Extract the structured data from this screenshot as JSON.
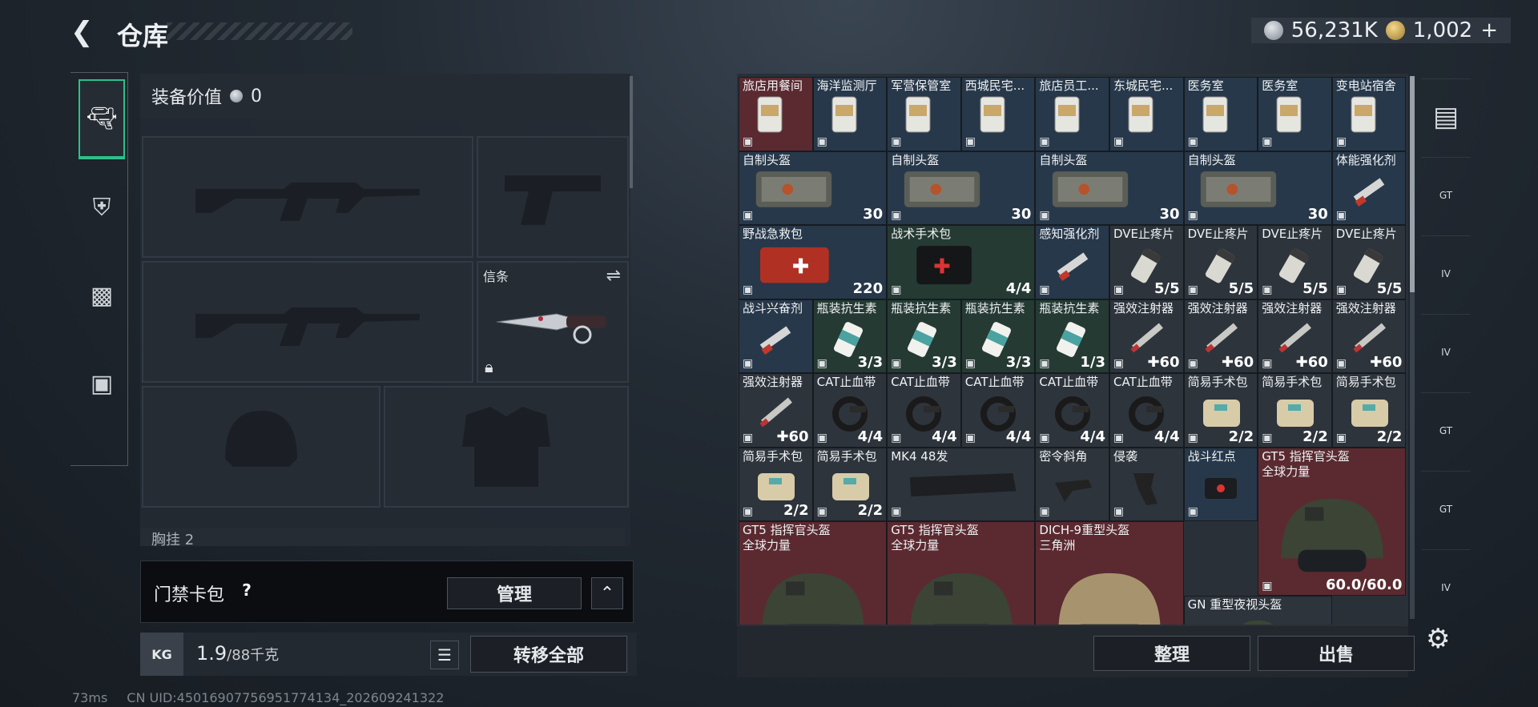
{
  "header": {
    "title": "仓库",
    "silver": "56,231K",
    "gold": "1,002",
    "gold_plus": "+"
  },
  "sidebar": {
    "tabs": [
      "weapons",
      "armor",
      "backpack",
      "medkit"
    ]
  },
  "loadout": {
    "value_label": "装备价值",
    "value": "0",
    "slot_melee_label": "信条",
    "chest_label": "胸挂 2"
  },
  "keycard": {
    "label": "门禁卡包",
    "help": "?",
    "manage": "管理",
    "collapse": "⌃"
  },
  "weight": {
    "kg": "KG",
    "current": "1.9",
    "max": "/88千克",
    "transfer": "转移全部"
  },
  "stash_footer": {
    "sort": "整理",
    "sell": "出售"
  },
  "stash_items": [
    {
      "name": "旅店用餐间",
      "col": 0,
      "row": 0,
      "w": 1,
      "h": 1,
      "color": "red",
      "icon": "keycard-icon"
    },
    {
      "name": "海洋监测厅",
      "col": 1,
      "row": 0,
      "w": 1,
      "h": 1,
      "color": "blue",
      "icon": "keycard-icon"
    },
    {
      "name": "军营保管室",
      "col": 2,
      "row": 0,
      "w": 1,
      "h": 1,
      "color": "blue",
      "icon": "keycard-icon"
    },
    {
      "name": "西城民宅...",
      "col": 3,
      "row": 0,
      "w": 1,
      "h": 1,
      "color": "blue",
      "icon": "keycard-icon"
    },
    {
      "name": "旅店员工...",
      "col": 4,
      "row": 0,
      "w": 1,
      "h": 1,
      "color": "blue",
      "icon": "keycard-icon"
    },
    {
      "name": "东城民宅...",
      "col": 5,
      "row": 0,
      "w": 1,
      "h": 1,
      "color": "blue",
      "icon": "keycard-icon"
    },
    {
      "name": "医务室",
      "col": 6,
      "row": 0,
      "w": 1,
      "h": 1,
      "color": "blue",
      "icon": "keycard-icon"
    },
    {
      "name": "医务室",
      "col": 7,
      "row": 0,
      "w": 1,
      "h": 1,
      "color": "blue",
      "icon": "keycard-icon"
    },
    {
      "name": "变电站宿舍",
      "col": 8,
      "row": 0,
      "w": 1,
      "h": 1,
      "color": "blue",
      "icon": "keycard-icon"
    },
    {
      "name": "自制头盔",
      "col": 0,
      "row": 1,
      "w": 2,
      "h": 1,
      "color": "blue",
      "qty": "30",
      "icon": "armor-plate-icon"
    },
    {
      "name": "自制头盔",
      "col": 2,
      "row": 1,
      "w": 2,
      "h": 1,
      "color": "blue",
      "qty": "30",
      "icon": "armor-plate-icon"
    },
    {
      "name": "自制头盔",
      "col": 4,
      "row": 1,
      "w": 2,
      "h": 1,
      "color": "blue",
      "qty": "30",
      "icon": "armor-plate-icon"
    },
    {
      "name": "自制头盔",
      "col": 6,
      "row": 1,
      "w": 2,
      "h": 1,
      "color": "blue",
      "qty": "30",
      "icon": "armor-plate-icon"
    },
    {
      "name": "体能强化剂",
      "col": 8,
      "row": 1,
      "w": 1,
      "h": 1,
      "color": "blue",
      "icon": "syringe-icon"
    },
    {
      "name": "野战急救包",
      "col": 0,
      "row": 2,
      "w": 2,
      "h": 1,
      "color": "blue",
      "qty": "220",
      "icon": "first-aid-kit-icon"
    },
    {
      "name": "战术手术包",
      "col": 2,
      "row": 2,
      "w": 2,
      "h": 1,
      "color": "green",
      "qty": "4/4",
      "icon": "surgery-kit-icon"
    },
    {
      "name": "感知强化剂",
      "col": 4,
      "row": 2,
      "w": 1,
      "h": 1,
      "color": "blue",
      "icon": "syringe-icon"
    },
    {
      "name": "DVE止疼片",
      "col": 5,
      "row": 2,
      "w": 1,
      "h": 1,
      "color": "gray",
      "qty": "5/5",
      "icon": "pill-bottle-icon"
    },
    {
      "name": "DVE止疼片",
      "col": 6,
      "row": 2,
      "w": 1,
      "h": 1,
      "color": "gray",
      "qty": "5/5",
      "icon": "pill-bottle-icon"
    },
    {
      "name": "DVE止疼片",
      "col": 7,
      "row": 2,
      "w": 1,
      "h": 1,
      "color": "gray",
      "qty": "5/5",
      "icon": "pill-bottle-icon"
    },
    {
      "name": "DVE止疼片",
      "col": 8,
      "row": 2,
      "w": 1,
      "h": 1,
      "color": "gray",
      "qty": "5/5",
      "icon": "pill-bottle-icon"
    },
    {
      "name": "战斗兴奋剂",
      "col": 0,
      "row": 3,
      "w": 1,
      "h": 1,
      "color": "blue",
      "icon": "syringe-icon"
    },
    {
      "name": "瓶装抗生素",
      "col": 1,
      "row": 3,
      "w": 1,
      "h": 1,
      "color": "green",
      "qty": "3/3",
      "icon": "bottle-icon"
    },
    {
      "name": "瓶装抗生素",
      "col": 2,
      "row": 3,
      "w": 1,
      "h": 1,
      "color": "green",
      "qty": "3/3",
      "icon": "bottle-icon"
    },
    {
      "name": "瓶装抗生素",
      "col": 3,
      "row": 3,
      "w": 1,
      "h": 1,
      "color": "green",
      "qty": "3/3",
      "icon": "bottle-icon"
    },
    {
      "name": "瓶装抗生素",
      "col": 4,
      "row": 3,
      "w": 1,
      "h": 1,
      "color": "green",
      "qty": "1/3",
      "icon": "bottle-icon"
    },
    {
      "name": "强效注射器",
      "col": 5,
      "row": 3,
      "w": 1,
      "h": 1,
      "color": "gray",
      "qty": "✚60",
      "icon": "injector-icon"
    },
    {
      "name": "强效注射器",
      "col": 6,
      "row": 3,
      "w": 1,
      "h": 1,
      "color": "gray",
      "qty": "✚60",
      "icon": "injector-icon"
    },
    {
      "name": "强效注射器",
      "col": 7,
      "row": 3,
      "w": 1,
      "h": 1,
      "color": "gray",
      "qty": "✚60",
      "icon": "injector-icon"
    },
    {
      "name": "强效注射器",
      "col": 8,
      "row": 3,
      "w": 1,
      "h": 1,
      "color": "gray",
      "qty": "✚60",
      "icon": "injector-icon"
    },
    {
      "name": "强效注射器",
      "col": 0,
      "row": 4,
      "w": 1,
      "h": 1,
      "color": "gray",
      "qty": "✚60",
      "icon": "injector-icon"
    },
    {
      "name": "CAT止血带",
      "col": 1,
      "row": 4,
      "w": 1,
      "h": 1,
      "color": "gray",
      "qty": "4/4",
      "icon": "tourniquet-icon"
    },
    {
      "name": "CAT止血带",
      "col": 2,
      "row": 4,
      "w": 1,
      "h": 1,
      "color": "gray",
      "qty": "4/4",
      "icon": "tourniquet-icon"
    },
    {
      "name": "CAT止血带",
      "col": 3,
      "row": 4,
      "w": 1,
      "h": 1,
      "color": "gray",
      "qty": "4/4",
      "icon": "tourniquet-icon"
    },
    {
      "name": "CAT止血带",
      "col": 4,
      "row": 4,
      "w": 1,
      "h": 1,
      "color": "gray",
      "qty": "4/4",
      "icon": "tourniquet-icon"
    },
    {
      "name": "CAT止血带",
      "col": 5,
      "row": 4,
      "w": 1,
      "h": 1,
      "color": "gray",
      "qty": "4/4",
      "icon": "tourniquet-icon"
    },
    {
      "name": "简易手术包",
      "col": 6,
      "row": 4,
      "w": 1,
      "h": 1,
      "color": "gray",
      "qty": "2/2",
      "icon": "pouch-icon"
    },
    {
      "name": "简易手术包",
      "col": 7,
      "row": 4,
      "w": 1,
      "h": 1,
      "color": "gray",
      "qty": "2/2",
      "icon": "pouch-icon"
    },
    {
      "name": "简易手术包",
      "col": 8,
      "row": 4,
      "w": 1,
      "h": 1,
      "color": "gray",
      "qty": "2/2",
      "icon": "pouch-icon"
    },
    {
      "name": "简易手术包",
      "col": 0,
      "row": 5,
      "w": 1,
      "h": 1,
      "color": "gray",
      "qty": "2/2",
      "icon": "pouch-icon"
    },
    {
      "name": "简易手术包",
      "col": 1,
      "row": 5,
      "w": 1,
      "h": 1,
      "color": "gray",
      "qty": "2/2",
      "icon": "pouch-icon"
    },
    {
      "name": "MK4 48发",
      "col": 2,
      "row": 5,
      "w": 2,
      "h": 1,
      "color": "gray",
      "icon": "magazine-icon"
    },
    {
      "name": "密令斜角",
      "col": 4,
      "row": 5,
      "w": 1,
      "h": 1,
      "color": "gray",
      "icon": "grip-icon"
    },
    {
      "name": "侵袭",
      "col": 5,
      "row": 5,
      "w": 1,
      "h": 1,
      "color": "gray",
      "icon": "pistol-grip-icon"
    },
    {
      "name": "战斗红点",
      "col": 6,
      "row": 5,
      "w": 1,
      "h": 1,
      "color": "blue",
      "icon": "red-dot-sight-icon"
    },
    {
      "name": "GT5 指挥官头盔",
      "sub": "全球力量",
      "col": 7,
      "row": 5,
      "w": 2,
      "h": 2,
      "color": "red",
      "qty": "60.0/60.0",
      "icon": "helmet-icon"
    },
    {
      "name": "GT5 指挥官头盔",
      "sub": "全球力量",
      "col": 0,
      "row": 6,
      "w": 2,
      "h": 2,
      "color": "red",
      "icon": "helmet-icon"
    },
    {
      "name": "GT5 指挥官头盔",
      "sub": "全球力量",
      "col": 2,
      "row": 6,
      "w": 2,
      "h": 2,
      "color": "red",
      "icon": "helmet-icon"
    },
    {
      "name": "DICH-9重型头盔",
      "sub": "三角洲",
      "col": 4,
      "row": 6,
      "w": 2,
      "h": 2,
      "color": "red",
      "icon": "helmet-tan-icon"
    },
    {
      "name": "GN 重型夜视头盔",
      "col": 6,
      "row": 7,
      "w": 2,
      "h": 1,
      "color": "gray",
      "icon": "helmet-icon"
    }
  ],
  "right_tabs": [
    "GT",
    "IV",
    "IV",
    "GT",
    "GT",
    "IV"
  ],
  "status": {
    "ping": "73ms",
    "uid": "CN UID:4501690775695177413‬4_202609241322"
  }
}
